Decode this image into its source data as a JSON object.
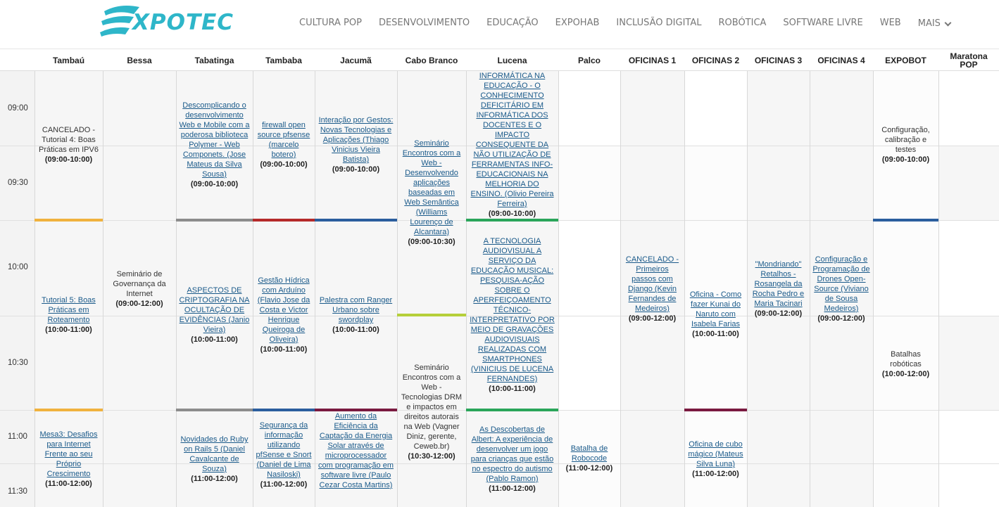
{
  "header": {
    "logo_text": "XPOTEC",
    "nav": [
      "CULTURA POP",
      "DESENVOLVIMENTO",
      "EDUCAÇÃO",
      "EXPOHAB",
      "INCLUSÃO DIGITAL",
      "ROBÓTICA",
      "SOFTWARE LIVRE",
      "WEB"
    ],
    "more_label": "MAIS"
  },
  "columns": [
    "Tambaú",
    "Bessa",
    "Tabatinga",
    "Tambaba",
    "Jacumã",
    "Cabo Branco",
    "Lucena",
    "Palco",
    "OFICINAS 1",
    "OFICINAS 2",
    "OFICINAS 3",
    "OFICINAS 4",
    "EXPOBOT",
    "Maratona POP"
  ],
  "times": [
    "09:00",
    "09:30",
    "10:00",
    "10:30",
    "11:00",
    "11:30"
  ],
  "colors": {
    "stripe_orange": "#f0b23e",
    "stripe_gray": "#8c8c8c",
    "stripe_red": "#b52a2a",
    "stripe_blue": "#2b5e9e",
    "stripe_green": "#2aa55a",
    "stripe_lime": "#b5cf3a",
    "stripe_maroon": "#7a1a40",
    "link": "#1a5a8a",
    "col_bg_light": "#f6f6f6"
  },
  "sessions": [
    {
      "title": "CANCELADO - Tutorial 4: Boas Práticas em IPV6",
      "time": "(09:00-10:00)"
    },
    {
      "title": "Tutorial 5: Boas Práticas em Roteamento",
      "time": "(10:00-11:00)"
    },
    {
      "title": "Mesa3: Desafios para Internet Frente ao seu Próprio Crescimento",
      "time": "(11:00-12:00)"
    },
    {
      "title": "Seminário de Governança da Internet",
      "time": "(09:00-12:00)"
    },
    {
      "title": "Descomplicando o desenvolvimento Web e Mobile com a poderosa biblioteca Polymer - Web Componets. (Jose Mateus da Silva Sousa)",
      "time": "(09:00-10:00)"
    },
    {
      "title": "ASPECTOS DE CRIPTOGRAFIA NA OCULTAÇÃO DE EVIDÊNCIAS (Janio Vieira)",
      "time": "(10:00-11:00)"
    },
    {
      "title": "Novidades do Ruby on Rails 5 (Daniel Cavalcante de Souza)",
      "time": "(11:00-12:00)"
    },
    {
      "title": "firewall open source pfsense (marcelo botero)",
      "time": "(09:00-10:00)"
    },
    {
      "title": "Gestão Hídrica com Arduíno (Flavio Jose da Costa e Victor Henrique Queiroga de Oliveira)",
      "time": "(10:00-11:00)"
    },
    {
      "title": "Segurança da informação utilizando pfSense e Snort (Daniel de Lima Nasiloski)",
      "time": "(11:00-12:00)"
    },
    {
      "title": "Interação por Gestos: Novas Tecnologias e Aplicações (Thiago Vinicius Vieira Batista)",
      "time": "(09:00-10:00)"
    },
    {
      "title": "Palestra com Ranger Urbano sobre swordplay",
      "time": "(10:00-11:00)"
    },
    {
      "title": "Aumento da Eficiência da Captação da Energia Solar através de microprocessador com programação em software livre (Paulo Cezar Costa Martins)",
      "time": ""
    },
    {
      "title": "Seminário Encontros com a Web - Desenvolvendo aplicações baseadas em Web Semântica (Williams Lourenço de Alcantara)",
      "time": "(09:00-10:30)"
    },
    {
      "title": "Seminário Encontros com a Web - Tecnologias DRM e impactos em direitos autorais na Web (Vagner Diniz, gerente, Ceweb.br)",
      "time": "(10:30-12:00)"
    },
    {
      "title": "INFORMÁTICA NA EDUCAÇÃO - O CONHECIMENTO DEFICITÁRIO EM INFORMÁTICA DOS DOCENTES E O IMPACTO CONSEQUENTE DA NÃO UTILIZAÇÃO DE FERRAMENTAS INFO-EDUCACIONAIS NA MELHORIA DO ENSINO. (Olivio Pereira Ferreira)",
      "time": "(09:00-10:00)"
    },
    {
      "title": "A TECNOLOGIA AUDIOVISUAL A SERVIÇO DA EDUCAÇÃO MUSICAL: PESQUISA-AÇÃO SOBRE O APERFEIÇOAMENTO TÉCNICO-INTERPRETATIVO POR MEIO DE GRAVAÇÕES AUDIOVISUAIS REALIZADAS COM SMARTPHONES (VINICIUS DE LUCENA FERNANDES)",
      "time": "(10:00-11:00)"
    },
    {
      "title": "As Descobertas de Albert: A experiência de desenvolver um jogo para crianças que estão no espectro do autismo (Pablo Ramon)",
      "time": "(11:00-12:00)"
    },
    {
      "title": "Batalha de Robocode",
      "time": "(11:00-12:00)"
    },
    {
      "title": "CANCELADO - Primeiros passos com Django (Kevin Fernandes de Medeiros)",
      "time": "(09:00-12:00)"
    },
    {
      "title": "Oficina - Como fazer Kunai do Naruto com Isabela Farias",
      "time": "(10:00-11:00)"
    },
    {
      "title": "Oficina de cubo mágico (Mateus Silva Luna)",
      "time": "(11:00-12:00)"
    },
    {
      "title": "\"Mondriando\" Retalhos - Rosangela da Rocha Pedro e Maria Tacinari",
      "time": "(09:00-12:00)"
    },
    {
      "title": "Configuração e Programação de Drones Open-Source (Viviano de Sousa Medeiros)",
      "time": "(09:00-12:00)"
    },
    {
      "title": "Configuração, calibração e testes",
      "time": "(09:00-10:00)"
    },
    {
      "title": "Batalhas robóticas",
      "time": "(10:00-12:00)"
    }
  ]
}
